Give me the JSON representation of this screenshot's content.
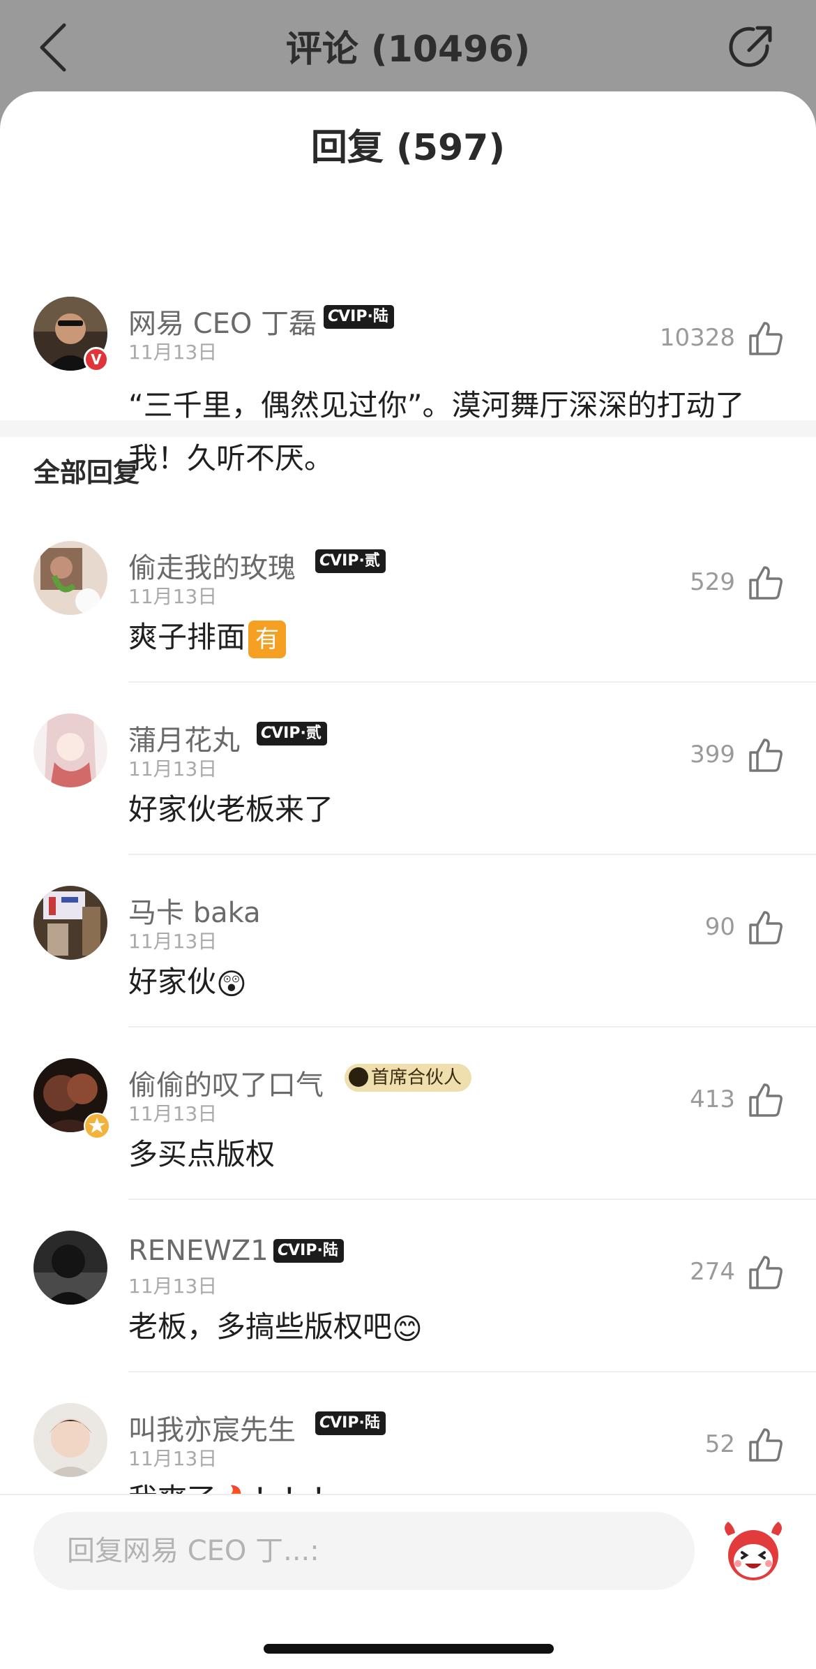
{
  "header": {
    "title": "评论 (10496)",
    "back_icon": "chevron-left-icon",
    "share_icon": "share-icon"
  },
  "sheet": {
    "title": "回复 (597)"
  },
  "main_comment": {
    "user": "网易 CEO 丁磊",
    "vip": "VIP·陆",
    "date": "11月13日",
    "likes": "10328",
    "text": "“三千里，偶然见过你”。漠河舞厅深深的打动了我！久听不厌。"
  },
  "section_title": "全部回复",
  "replies": [
    {
      "user": "偷走我的玫瑰",
      "badge": "VIP·贰",
      "date": "11月13日",
      "likes": "529",
      "text": "爽子排面",
      "emoji": "有"
    },
    {
      "user": "蒲月花丸",
      "badge": "VIP·贰",
      "date": "11月13日",
      "likes": "399",
      "text": "好家伙老板来了"
    },
    {
      "user": "马卡 baka",
      "date": "11月13日",
      "likes": "90",
      "text": "好家伙",
      "emoji": "😲"
    },
    {
      "user": "偷偷的叹了口气",
      "badge": "首席合伙人",
      "date": "11月13日",
      "likes": "413",
      "text": "多买点版权"
    },
    {
      "user": "RENEWZ1",
      "badge": "VIP·陆",
      "date": "11月13日",
      "likes": "274",
      "text": "老板，多搞些版权吧",
      "emoji": "😊"
    },
    {
      "user": "叫我亦宸先生",
      "badge": "VIP·陆",
      "date": "11月13日",
      "likes": "52",
      "text": "我爽了",
      "emoji": "🔥",
      "tail": "！！！"
    }
  ],
  "input": {
    "placeholder": "回复网易 CEO 丁...:"
  },
  "icons": {
    "thumb": "thumbs-up-icon",
    "mascot": "cloud-mascot-icon"
  },
  "colors": {
    "overlay": "#9a9a9a",
    "vip_badge": "#1c1c1c",
    "partner_badge": "#f0dfae",
    "verified": "#e0343a"
  }
}
